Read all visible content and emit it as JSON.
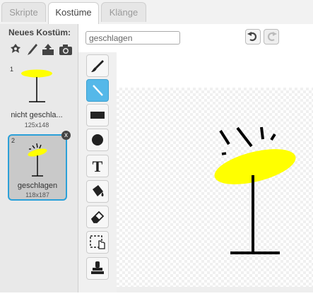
{
  "tabs": {
    "scripts": "Skripte",
    "costumes": "Kostüme",
    "sounds": "Klänge"
  },
  "left": {
    "new_costume_label": "Neues Kostüm:",
    "new_icons": [
      "sprite-library-icon",
      "paint-brush-icon",
      "upload-icon",
      "camera-icon"
    ],
    "costumes": [
      {
        "number": "1",
        "name": "nicht geschla...",
        "size": "125x148"
      },
      {
        "number": "2",
        "name": "geschlagen",
        "size": "118x187",
        "close": "x"
      }
    ]
  },
  "editor": {
    "costume_name": "geschlagen",
    "tools": [
      "brush",
      "line",
      "rectangle",
      "ellipse",
      "text",
      "fill",
      "eraser",
      "select",
      "stamp"
    ],
    "selected_tool": "line",
    "text_tool_glyph": "T"
  },
  "colors": {
    "selection_blue": "#2ba0d8",
    "tool_selected": "#55b8e9",
    "paddle_yellow": "#ffff00",
    "ink": "#000000"
  }
}
